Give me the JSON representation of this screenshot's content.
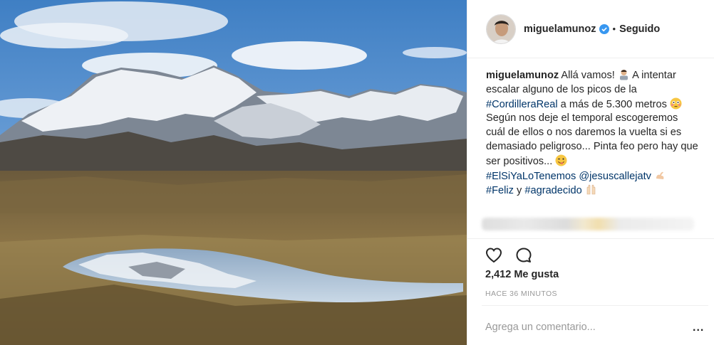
{
  "header": {
    "username": "miguelamunoz",
    "separator": "•",
    "follow_status": "Seguido"
  },
  "caption": {
    "username": "miguelamunoz",
    "text1": "Allá vamos!",
    "text2": "A intentar escalar alguno de los picos de la",
    "hashtag1": "#CordilleraReal",
    "text3": "a más de 5.300 metros",
    "text4": "Según nos deje el temporal escogeremos cuál de ellos o nos daremos la vuelta si es demasiado peligroso... Pinta feo pero hay que ser positivos...",
    "hashtag2": "#ElSiYaLoTenemos",
    "mention": "@jesuscallejatv",
    "hashtag3": "#Feliz",
    "text5": "y",
    "hashtag4": "#agradecido"
  },
  "actions": {
    "like_icon": "heart-icon",
    "comment_icon": "comment-icon"
  },
  "likes": "2,412 Me gusta",
  "time": "HACE 36 MINUTOS",
  "comment_placeholder": "Agrega un comentario...",
  "more_label": "..."
}
